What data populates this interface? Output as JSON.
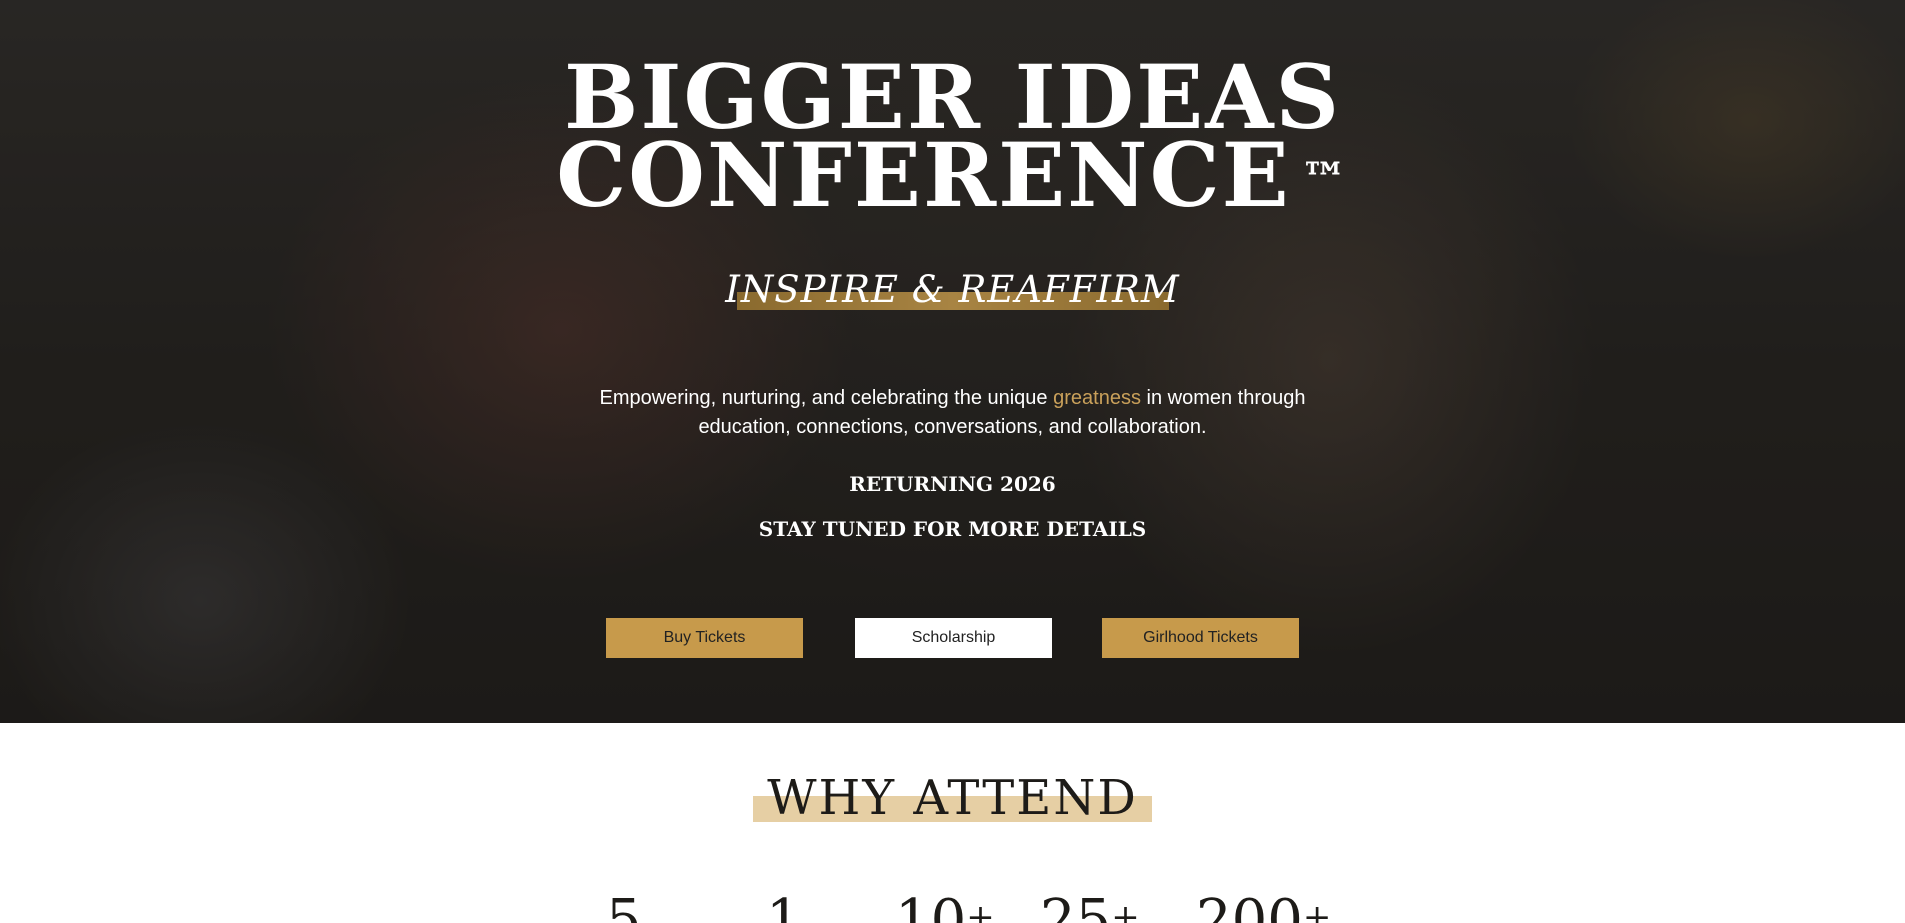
{
  "hero": {
    "title_line1": "BIGGER IDEAS",
    "title_line2": "CONFERENCE",
    "trademark": "™",
    "tagline": "INSPIRE & REAFFIRM",
    "mission_before": "Empowering, nurturing, and celebrating the unique ",
    "mission_accent": "greatness",
    "mission_after": " in women through education, connections, conversations, and collaboration.",
    "returning": "RETURNING 2026",
    "stay_tuned": "STAY TUNED FOR MORE DETAILS",
    "buttons": {
      "buy_tickets": "Buy Tickets",
      "scholarship": "Scholarship",
      "girlhood_tickets": "Girlhood Tickets"
    }
  },
  "why_attend": {
    "title": "WHY ATTEND",
    "stats": [
      {
        "value": "5",
        "suffix": ""
      },
      {
        "value": "1",
        "suffix": ""
      },
      {
        "value": "10",
        "suffix": "+"
      },
      {
        "value": "25",
        "suffix": "+"
      },
      {
        "value": "200",
        "suffix": "+"
      }
    ]
  },
  "colors": {
    "accent_gold": "#c79a4b",
    "highlight_beige": "#e6cfa4",
    "hero_dark": "#2a2826"
  }
}
